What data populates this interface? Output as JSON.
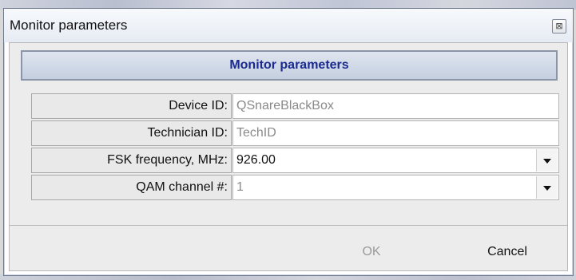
{
  "window": {
    "title": "Monitor parameters",
    "close_glyph": "⊠"
  },
  "panel": {
    "header": "Monitor parameters"
  },
  "fields": [
    {
      "label": "Device ID:",
      "value": "QSnareBlackBox",
      "kind": "text",
      "state": "readonly"
    },
    {
      "label": "Technician ID:",
      "value": "TechID",
      "kind": "text",
      "state": "readonly"
    },
    {
      "label": "FSK frequency, MHz:",
      "value": "926.00",
      "kind": "dropdown",
      "state": "enabled"
    },
    {
      "label": "QAM channel #:",
      "value": "1",
      "kind": "dropdown",
      "state": "disabled"
    }
  ],
  "buttons": {
    "ok_label": "OK",
    "ok_state": "disabled",
    "cancel_label": "Cancel"
  },
  "colors": {
    "header_text": "#1a2a8f",
    "disabled_text": "#8a8a8a"
  }
}
